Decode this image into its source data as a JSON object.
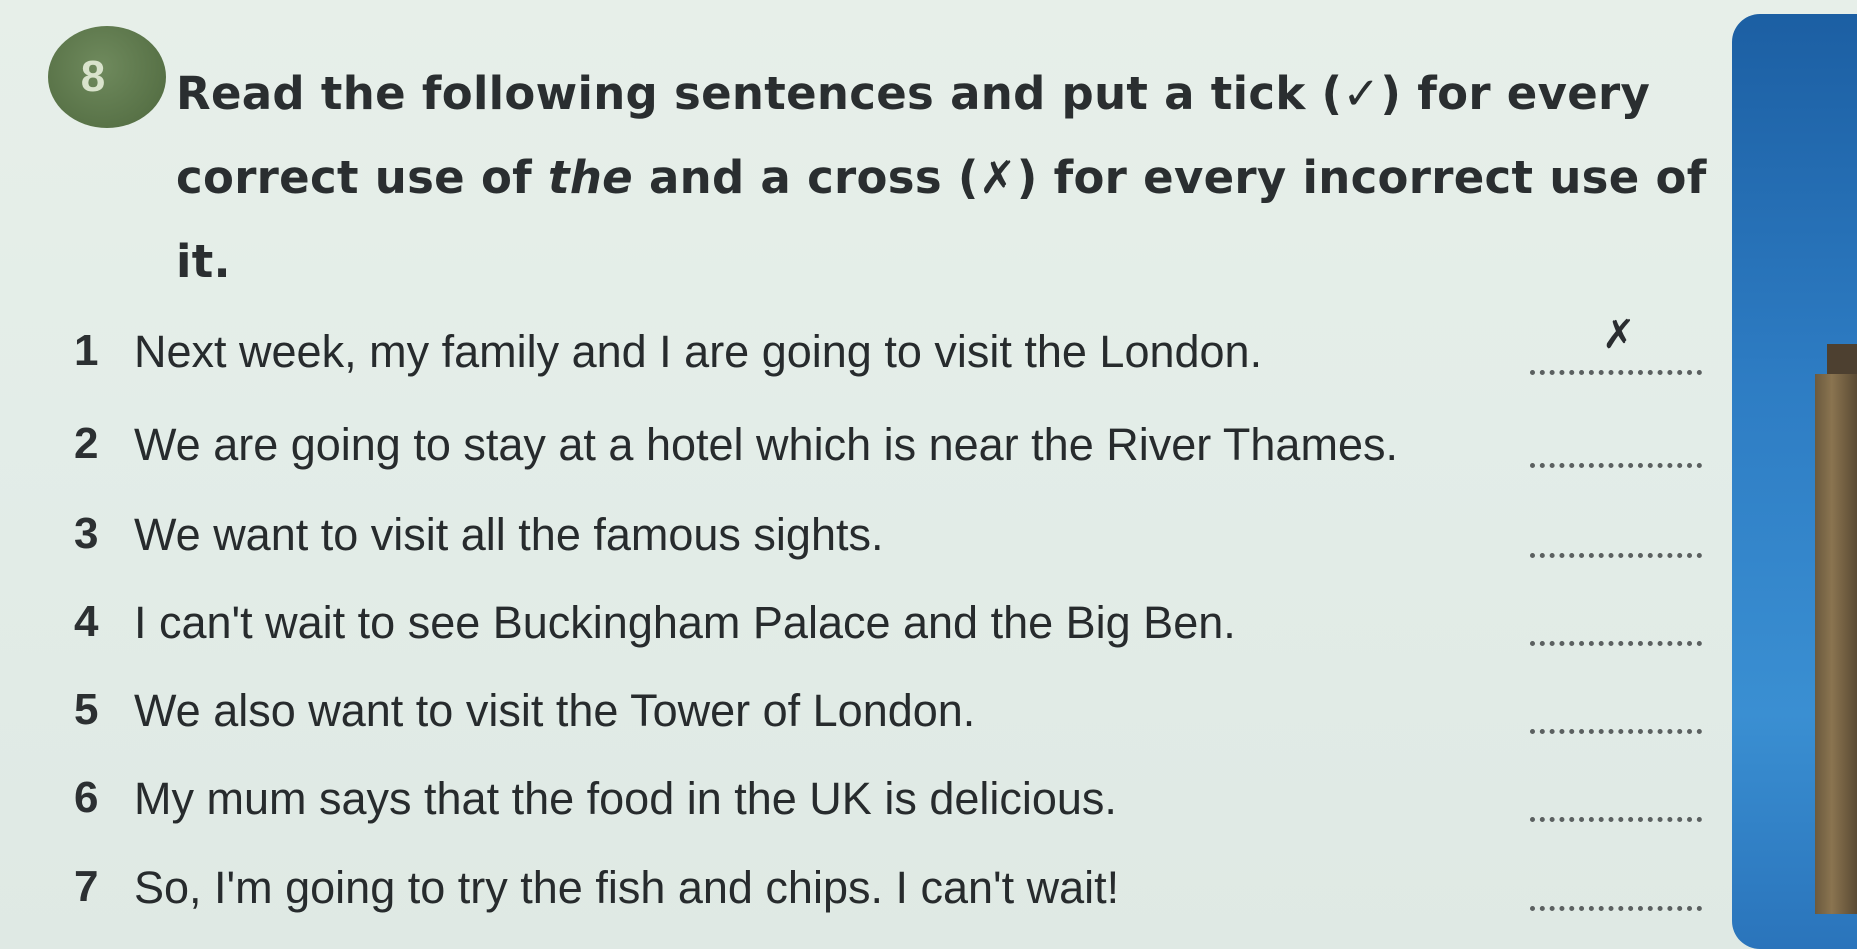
{
  "exercise": {
    "number": "8",
    "instruction_part1": "Read the following sentences and put a tick (✓) for every correct use of ",
    "instruction_em": "the",
    "instruction_part2": " and a cross (✗) for every incorrect use of it."
  },
  "items": [
    {
      "number": "1",
      "text": "Next week, my family and I are going to visit the London.",
      "answer": "✗"
    },
    {
      "number": "2",
      "text": "We are going to stay at a hotel which is near the River Thames.",
      "answer": ""
    },
    {
      "number": "3",
      "text": "We want to visit all the famous sights.",
      "answer": ""
    },
    {
      "number": "4",
      "text": "I can't wait to see Buckingham Palace and the Big Ben.",
      "answer": ""
    },
    {
      "number": "5",
      "text": "We also want to visit the Tower of London.",
      "answer": ""
    },
    {
      "number": "6",
      "text": "My mum says that the food in the UK is delicious.",
      "answer": ""
    },
    {
      "number": "7",
      "text": "So, I'm going to try the fish and chips. I can't wait!",
      "answer": ""
    }
  ],
  "colors": {
    "badge": "#587247",
    "photo_sky": "#2e7dc4",
    "page": "#e3ede8"
  }
}
